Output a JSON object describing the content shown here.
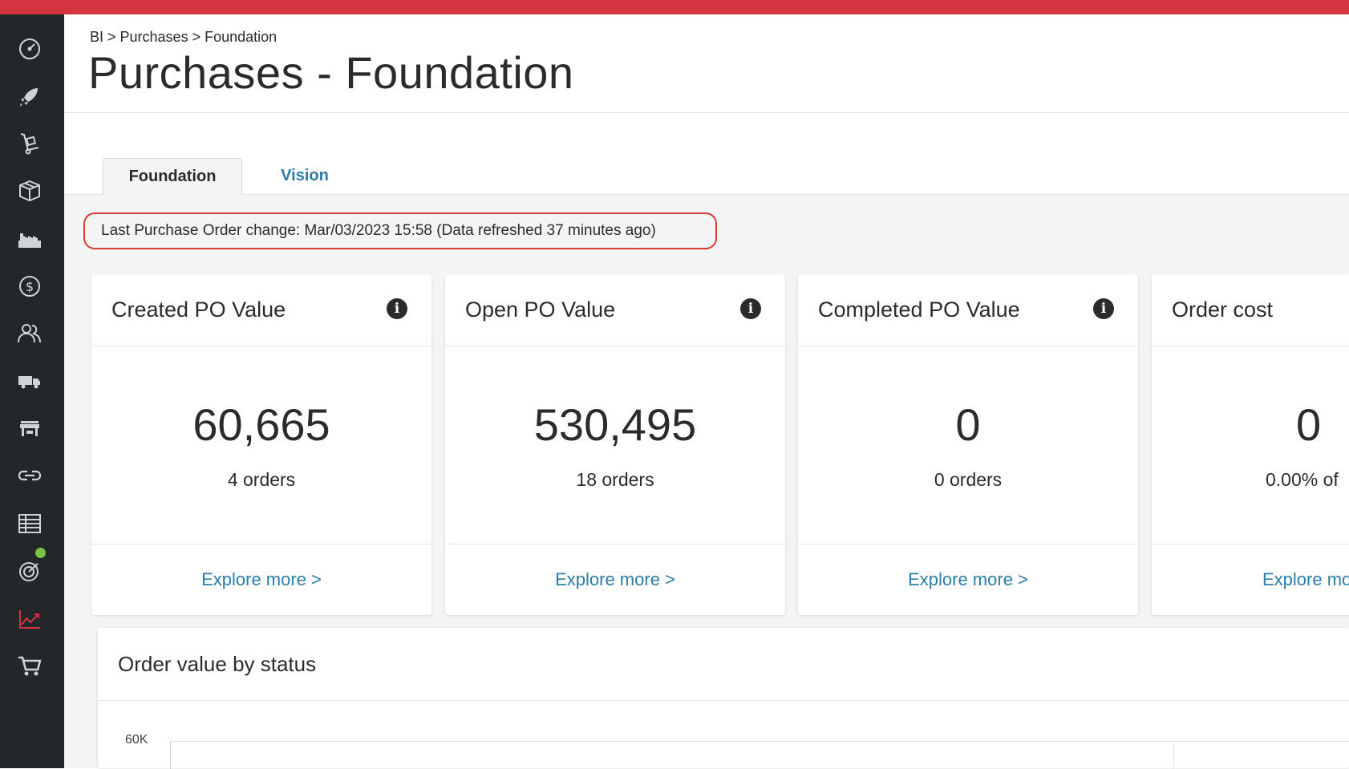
{
  "breadcrumb": "BI > Purchases > Foundation",
  "page_title": "Purchases - Foundation",
  "tabs": [
    {
      "label": "Foundation",
      "active": true
    },
    {
      "label": "Vision",
      "active": false
    }
  ],
  "status_note": "Last Purchase Order change: Mar/03/2023 15:58 (Data refreshed 37 minutes ago)",
  "cards": [
    {
      "title": "Created PO Value",
      "value": "60,665",
      "sub": "4 orders",
      "link": "Explore more >"
    },
    {
      "title": "Open PO Value",
      "value": "530,495",
      "sub": "18 orders",
      "link": "Explore more >"
    },
    {
      "title": "Completed PO Value",
      "value": "0",
      "sub": "0 orders",
      "link": "Explore more >"
    },
    {
      "title": "Order cost",
      "value": "0",
      "sub": "0.00% of",
      "link": "Explore more"
    }
  ],
  "chart": {
    "title": "Order value by status",
    "y_tick": "60K"
  },
  "sidebar_icons": [
    "dashboard-icon",
    "rocket-icon",
    "hand-truck-icon",
    "package-icon",
    "factory-icon",
    "dollar-icon",
    "users-icon",
    "truck-icon",
    "store-icon",
    "link-icon",
    "table-icon",
    "radar-icon",
    "trend-chart-icon",
    "cart-icon"
  ],
  "colors": {
    "topbar": "#d4343f",
    "sidebar": "#23272a",
    "link": "#2a7ea8",
    "highlight_border": "#d43b33",
    "status_dot": "#7cc242"
  }
}
